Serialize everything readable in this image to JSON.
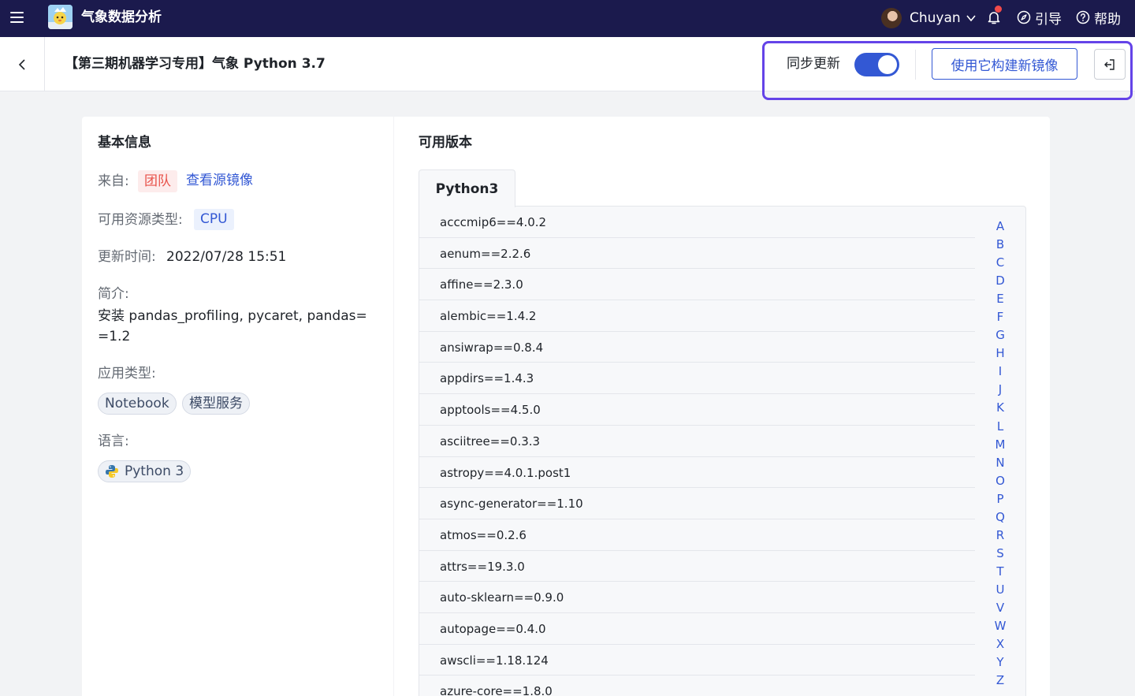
{
  "topbar": {
    "app_title": "气象数据分析",
    "user_name": "Chuyan",
    "guide_label": "引导",
    "help_label": "帮助",
    "notification_dot_color": "#f24a4a",
    "icons": [
      "menu-icon",
      "app-logo",
      "avatar",
      "chevron-down-icon",
      "bell-icon",
      "compass-icon",
      "question-circle-icon"
    ]
  },
  "header": {
    "title": "【第三期机器学习专用】气象 Python 3.7",
    "sync_label": "同步更新",
    "sync_enabled": true,
    "build_button_label": "使用它构建新镜像",
    "icons": [
      "chevron-left-icon",
      "exit-icon"
    ]
  },
  "annotation": {
    "highlight_color": "#6443e8",
    "arrow_color": "#6443e8"
  },
  "basic_info": {
    "section_title": "基本信息",
    "source_label": "来自:",
    "source_tag": "团队",
    "view_source_link": "查看源镜像",
    "resource_type_label": "可用资源类型:",
    "resource_type_value": "CPU",
    "updated_label": "更新时间:",
    "updated_value": "2022/07/28 15:51",
    "intro_label": "简介:",
    "intro_value": "安装 pandas_profiling, pycaret, pandas==1.2",
    "app_type_label": "应用类型:",
    "app_types": [
      "Notebook",
      "模型服务"
    ],
    "language_label": "语言:",
    "language_value": "Python 3"
  },
  "versions": {
    "section_title": "可用版本",
    "tab_label": "Python3",
    "packages": [
      "acccmip6==4.0.2",
      "aenum==2.2.6",
      "affine==2.3.0",
      "alembic==1.4.2",
      "ansiwrap==0.8.4",
      "appdirs==1.4.3",
      "apptools==4.5.0",
      "asciitree==0.3.3",
      "astropy==4.0.1.post1",
      "async-generator==1.10",
      "atmos==0.2.6",
      "attrs==19.3.0",
      "auto-sklearn==0.9.0",
      "autopage==0.4.0",
      "awscli==1.18.124",
      "azure-core==1.8.0"
    ],
    "alphabet": [
      "A",
      "B",
      "C",
      "D",
      "E",
      "F",
      "G",
      "H",
      "I",
      "J",
      "K",
      "L",
      "M",
      "N",
      "O",
      "P",
      "Q",
      "R",
      "S",
      "T",
      "U",
      "V",
      "W",
      "X",
      "Y",
      "Z"
    ]
  },
  "colors": {
    "nav_bg": "#1b1a4d",
    "accent": "#3358d4",
    "tag_red": "#e8524a"
  }
}
